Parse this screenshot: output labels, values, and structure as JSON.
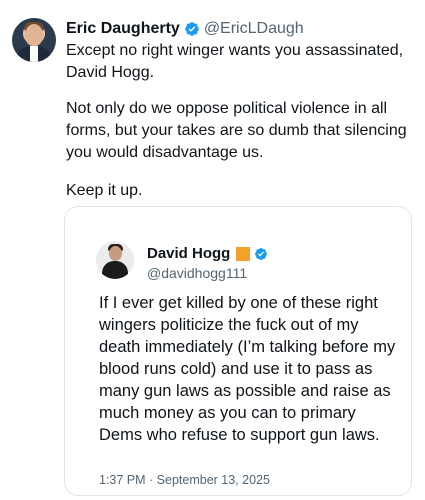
{
  "author": {
    "name": "Eric Daugherty",
    "handle": "@EricLDaugh"
  },
  "tweet": {
    "paragraphs": [
      "Except no right winger wants you assassinated, David Hogg.",
      "Not only do we oppose political violence in all forms, but your takes are so dumb that silencing you would disadvantage us.",
      "Keep it up."
    ]
  },
  "quoted": {
    "name": "David Hogg",
    "handle": "@davidhogg111",
    "text": "If I ever get killed by one of these right wingers politicize the fuck out of my death immediately (I’m talking before my blood runs cold) and use it to pass as many gun laws as possible and raise as much money as you can to primary Dems who refuse to support gun laws.",
    "timestamp": "1:37 PM · September 13, 2025"
  },
  "colors": {
    "verified_blue": "#1d9bf0",
    "orange_badge": "#f4a12a",
    "secondary_text": "#536471",
    "border": "#e1e5e9"
  },
  "icons": {
    "verified": "verified-badge-icon",
    "orange": "orange-square-icon"
  }
}
